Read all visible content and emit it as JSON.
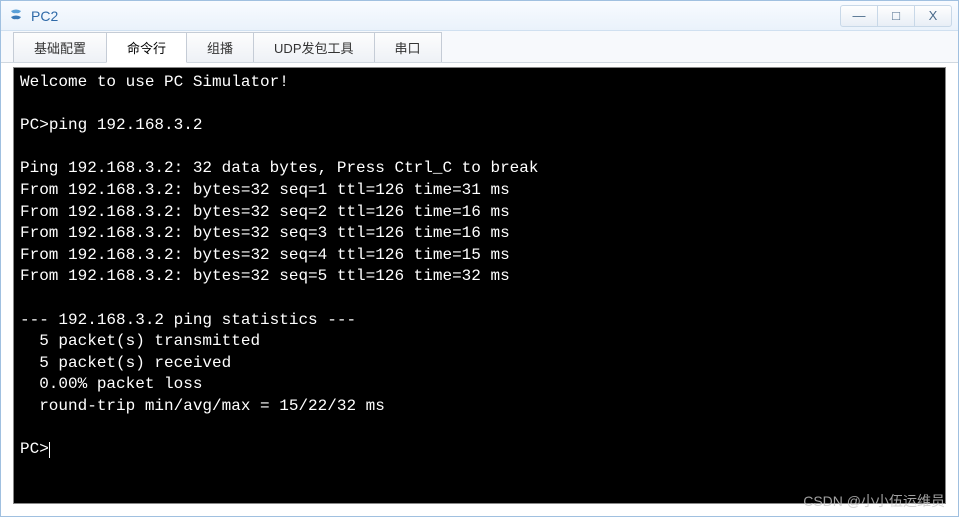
{
  "window": {
    "title": "PC2"
  },
  "controls": {
    "minimize": "—",
    "maximize": "□",
    "close": "X"
  },
  "tabs": [
    {
      "label": "基础配置",
      "active": false
    },
    {
      "label": "命令行",
      "active": true
    },
    {
      "label": "组播",
      "active": false
    },
    {
      "label": "UDP发包工具",
      "active": false
    },
    {
      "label": "串口",
      "active": false
    }
  ],
  "terminal": {
    "welcome": "Welcome to use PC Simulator!",
    "prompt": "PC>",
    "command": "ping 192.168.3.2",
    "ping_header": "Ping 192.168.3.2: 32 data bytes, Press Ctrl_C to break",
    "replies": [
      "From 192.168.3.2: bytes=32 seq=1 ttl=126 time=31 ms",
      "From 192.168.3.2: bytes=32 seq=2 ttl=126 time=16 ms",
      "From 192.168.3.2: bytes=32 seq=3 ttl=126 time=16 ms",
      "From 192.168.3.2: bytes=32 seq=4 ttl=126 time=15 ms",
      "From 192.168.3.2: bytes=32 seq=5 ttl=126 time=32 ms"
    ],
    "stats_header": "--- 192.168.3.2 ping statistics ---",
    "stats_tx": "  5 packet(s) transmitted",
    "stats_rx": "  5 packet(s) received",
    "stats_loss": "  0.00% packet loss",
    "stats_rtt": "  round-trip min/avg/max = 15/22/32 ms"
  },
  "watermark": "CSDN @小小伍运维员"
}
